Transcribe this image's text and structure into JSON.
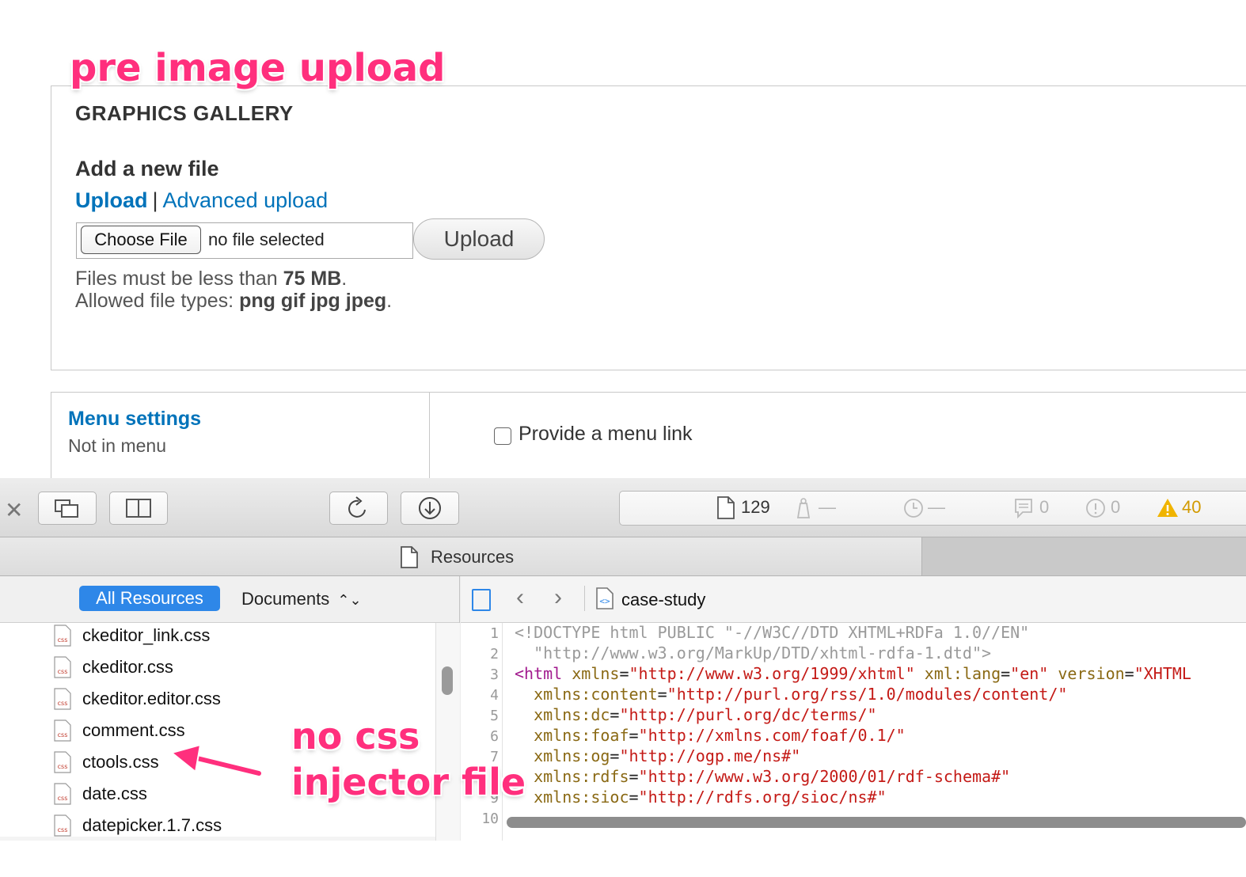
{
  "annotations": {
    "pre_upload": "pre image upload",
    "no_css_line1": "no css",
    "no_css_line2": "injector file"
  },
  "gallery": {
    "title": "GRAPHICS GALLERY",
    "add_file_title": "Add a new file",
    "upload_link": "Upload",
    "separator": "|",
    "advanced_upload_link": "Advanced upload",
    "choose_file_label": "Choose File",
    "no_file_text": "no file selected",
    "upload_button": "Upload",
    "help_size_prefix": "Files must be less than",
    "help_size_value": "75 MB",
    "help_types_prefix": "Allowed file types:",
    "help_types_value": "png gif jpg jpeg"
  },
  "menu": {
    "title": "Menu settings",
    "status": "Not in menu",
    "checkbox_label": "Provide a menu link",
    "checkbox_checked": false
  },
  "devtools": {
    "stats": {
      "resources_count": "129",
      "size_placeholder": "—",
      "time_placeholder": "—",
      "logs": "0",
      "errors": "0",
      "warnings": "40"
    },
    "tab_label": "Resources",
    "filter_all": "All Resources",
    "filter_docs": "Documents",
    "breadcrumb": "case-study",
    "files": [
      "ckeditor_link.css",
      "ckeditor.css",
      "ckeditor.editor.css",
      "comment.css",
      "ctools.css",
      "date.css",
      "datepicker.1.7.css"
    ],
    "file_icon_label": "css",
    "line_numbers": [
      "1",
      "2",
      "3",
      "4",
      "5",
      "6",
      "7",
      "8",
      "9",
      "10"
    ],
    "code": {
      "l1": "<!DOCTYPE html PUBLIC \"-//W3C//DTD XHTML+RDFa 1.0//EN\"",
      "l2": "  \"http://www.w3.org/MarkUp/DTD/xhtml-rdfa-1.dtd\">",
      "l3_tag": "<html",
      "l3_a1": " xmlns",
      "l3_v1": "\"http://www.w3.org/1999/xhtml\"",
      "l3_a2": " xml:lang",
      "l3_v2": "\"en\"",
      "l3_a3": " version",
      "l3_v3": "\"XHTML",
      "l4_a": "  xmlns:content",
      "l4_v": "\"http://purl.org/rss/1.0/modules/content/\"",
      "l5_a": "  xmlns:dc",
      "l5_v": "\"http://purl.org/dc/terms/\"",
      "l6_a": "  xmlns:foaf",
      "l6_v": "\"http://xmlns.com/foaf/0.1/\"",
      "l7_a": "  xmlns:og",
      "l7_v": "\"http://ogp.me/ns#\"",
      "l8_a": "  xmlns:rdfs",
      "l8_v": "\"http://www.w3.org/2000/01/rdf-schema#\"",
      "l9_a": "  xmlns:sioc",
      "l9_v": "\"http://rdfs.org/sioc/ns#\""
    }
  },
  "colors": {
    "annotation": "#ff2f7d",
    "link": "#0073ba",
    "active_filter": "#2e87e8",
    "warning": "#d29a00"
  }
}
